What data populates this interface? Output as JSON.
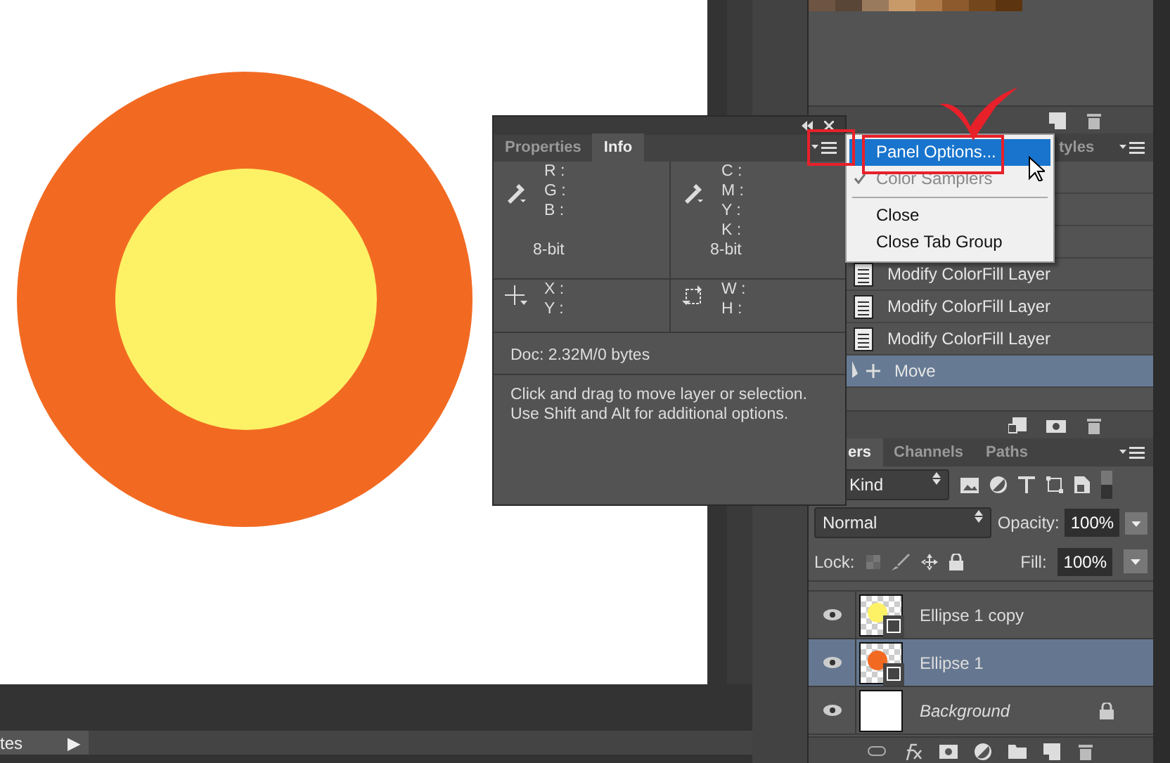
{
  "swatches": [
    {
      "color": "#6e5443"
    },
    {
      "color": "#5a4636"
    },
    {
      "color": "#9a7a5c"
    },
    {
      "color": "#c89a6a"
    },
    {
      "color": "#b07a48"
    },
    {
      "color": "#8c5a2c"
    },
    {
      "color": "#74461c"
    },
    {
      "color": "#5c3410"
    }
  ],
  "status_bar": {
    "text": "tes",
    "arrow": "▶"
  },
  "info_panel": {
    "tabs": [
      {
        "label": "Properties",
        "selected": false
      },
      {
        "label": "Info",
        "selected": true
      }
    ],
    "color_left": {
      "labels": [
        "R :",
        "G :",
        "B :"
      ],
      "depth": "8-bit"
    },
    "color_right": {
      "labels": [
        "C :",
        "M :",
        "Y :",
        "K :"
      ],
      "depth": "8-bit"
    },
    "position": {
      "labels": [
        "X :",
        "Y :"
      ]
    },
    "size": {
      "labels": [
        "W :",
        "H :"
      ]
    },
    "doc": "Doc: 2.32M/0 bytes",
    "hint": "Click and drag to move layer or selection.\nUse Shift and Alt for additional options."
  },
  "panel_menu": {
    "items": [
      {
        "label": "Panel Options...",
        "highlighted": true,
        "checked": false,
        "disabled": false
      },
      {
        "label": "Color Samplers",
        "highlighted": false,
        "checked": true,
        "disabled": true
      },
      {
        "label": "Close",
        "highlighted": false,
        "checked": false,
        "disabled": false,
        "divider_before": true
      },
      {
        "label": "Close Tab Group",
        "highlighted": false,
        "checked": false,
        "disabled": false
      }
    ]
  },
  "history_panel": {
    "tab": "tyles",
    "rows": [
      {
        "label": "Modify ColorFill Layer",
        "kind": "step",
        "selected": false
      },
      {
        "label": "Modify ColorFill Layer",
        "kind": "step",
        "selected": false
      },
      {
        "label": "Modify ColorFill Layer",
        "kind": "step",
        "selected": false
      },
      {
        "label": "Move",
        "kind": "move",
        "selected": true
      }
    ]
  },
  "layers_panel": {
    "tabs": [
      {
        "label": "ers",
        "selected": true
      },
      {
        "label": "Channels",
        "selected": false
      },
      {
        "label": "Paths",
        "selected": false
      }
    ],
    "filter": "Kind",
    "blend_mode": "Normal",
    "opacity_label": "Opacity:",
    "opacity": "100%",
    "lock_label": "Lock:",
    "fill_label": "Fill:",
    "fill": "100%",
    "layers": [
      {
        "name": "Ellipse 1 copy",
        "kind": "shape",
        "visible": true,
        "selected": false
      },
      {
        "name": "Ellipse 1",
        "kind": "shape",
        "visible": true,
        "selected": true
      },
      {
        "name": "Background",
        "kind": "background",
        "visible": true,
        "selected": false
      }
    ]
  }
}
